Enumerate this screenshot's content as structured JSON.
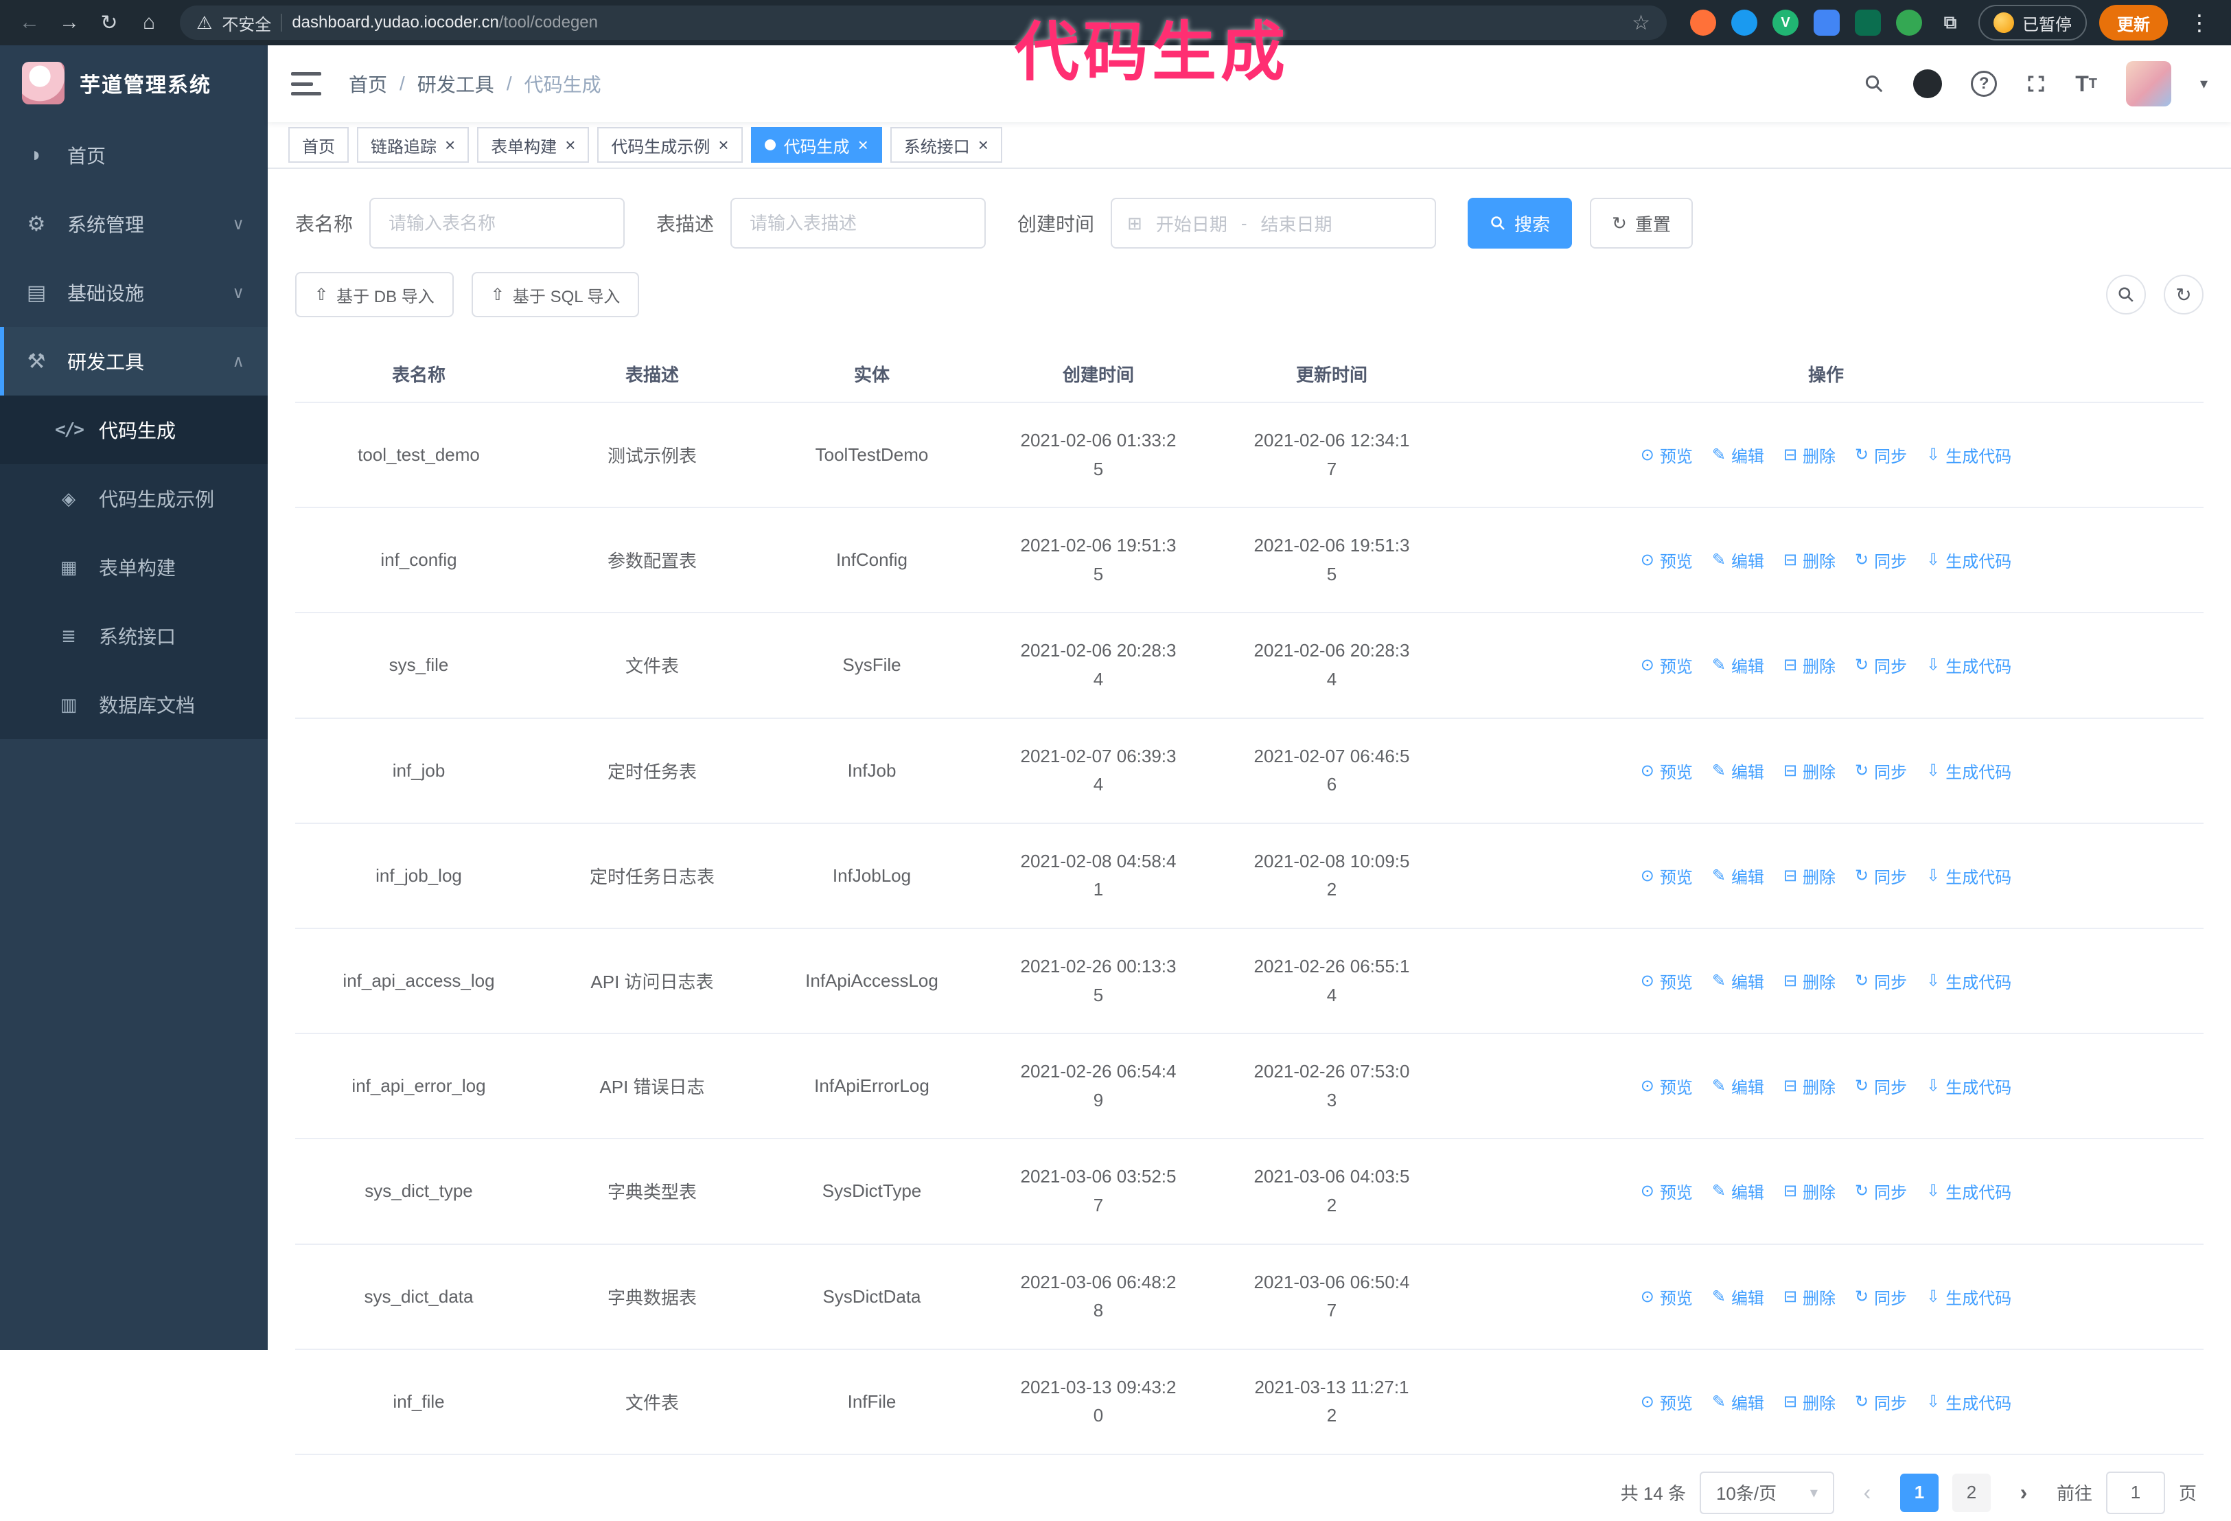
{
  "colors": {
    "accent": "#409eff",
    "sidebar_bg": "#2a3e52",
    "submenu_bg": "#203244",
    "annotation_pink": "#ff2e72",
    "update_button_orange": "#e8710a"
  },
  "browser": {
    "security_warning": "不安全",
    "url_host": "dashboard.yudao.iocoder.cn",
    "url_path": "/tool/codegen",
    "paused_badge": "已暂停",
    "update_button": "更新"
  },
  "annotation": {
    "text": "代码生成"
  },
  "sidebar": {
    "logo_title": "芋道管理系统",
    "items": [
      {
        "label": "首页"
      },
      {
        "label": "系统管理"
      },
      {
        "label": "基础设施"
      },
      {
        "label": "研发工具"
      }
    ],
    "submenu": [
      {
        "label": "代码生成"
      },
      {
        "label": "代码生成示例"
      },
      {
        "label": "表单构建"
      },
      {
        "label": "系统接口"
      },
      {
        "label": "数据库文档"
      }
    ]
  },
  "breadcrumb": {
    "items": [
      "首页",
      "研发工具",
      "代码生成"
    ]
  },
  "tabs": [
    {
      "label": "首页"
    },
    {
      "label": "链路追踪"
    },
    {
      "label": "表单构建"
    },
    {
      "label": "代码生成示例"
    },
    {
      "label": "代码生成"
    },
    {
      "label": "系统接口"
    }
  ],
  "filters": {
    "name_label": "表名称",
    "name_placeholder": "请输入表名称",
    "desc_label": "表描述",
    "desc_placeholder": "请输入表描述",
    "time_label": "创建时间",
    "start_placeholder": "开始日期",
    "separator": "-",
    "end_placeholder": "结束日期",
    "search_button": "搜索",
    "reset_button": "重置"
  },
  "toolbar": {
    "import_db": "基于 DB 导入",
    "import_sql": "基于 SQL 导入"
  },
  "table": {
    "columns": [
      "表名称",
      "表描述",
      "实体",
      "创建时间",
      "更新时间",
      "操作"
    ],
    "actions": [
      "预览",
      "编辑",
      "删除",
      "同步",
      "生成代码"
    ],
    "rows": [
      {
        "name": "tool_test_demo",
        "desc": "测试示例表",
        "entity": "ToolTestDemo",
        "created": "2021-02-06 01:33:25",
        "updated": "2021-02-06 12:34:17"
      },
      {
        "name": "inf_config",
        "desc": "参数配置表",
        "entity": "InfConfig",
        "created": "2021-02-06 19:51:35",
        "updated": "2021-02-06 19:51:35"
      },
      {
        "name": "sys_file",
        "desc": "文件表",
        "entity": "SysFile",
        "created": "2021-02-06 20:28:34",
        "updated": "2021-02-06 20:28:34"
      },
      {
        "name": "inf_job",
        "desc": "定时任务表",
        "entity": "InfJob",
        "created": "2021-02-07 06:39:34",
        "updated": "2021-02-07 06:46:56"
      },
      {
        "name": "inf_job_log",
        "desc": "定时任务日志表",
        "entity": "InfJobLog",
        "created": "2021-02-08 04:58:41",
        "updated": "2021-02-08 10:09:52"
      },
      {
        "name": "inf_api_access_log",
        "desc": "API 访问日志表",
        "entity": "InfApiAccessLog",
        "created": "2021-02-26 00:13:35",
        "updated": "2021-02-26 06:55:14"
      },
      {
        "name": "inf_api_error_log",
        "desc": "API 错误日志",
        "entity": "InfApiErrorLog",
        "created": "2021-02-26 06:54:49",
        "updated": "2021-02-26 07:53:03"
      },
      {
        "name": "sys_dict_type",
        "desc": "字典类型表",
        "entity": "SysDictType",
        "created": "2021-03-06 03:52:57",
        "updated": "2021-03-06 04:03:52"
      },
      {
        "name": "sys_dict_data",
        "desc": "字典数据表",
        "entity": "SysDictData",
        "created": "2021-03-06 06:48:28",
        "updated": "2021-03-06 06:50:47"
      },
      {
        "name": "inf_file",
        "desc": "文件表",
        "entity": "InfFile",
        "created": "2021-03-13 09:43:20",
        "updated": "2021-03-13 11:27:12"
      }
    ]
  },
  "pagination": {
    "total": "共 14 条",
    "page_size": "10条/页",
    "page_1": "1",
    "page_2": "2",
    "goto_label": "前往",
    "goto_value": "1",
    "goto_suffix": "页"
  }
}
